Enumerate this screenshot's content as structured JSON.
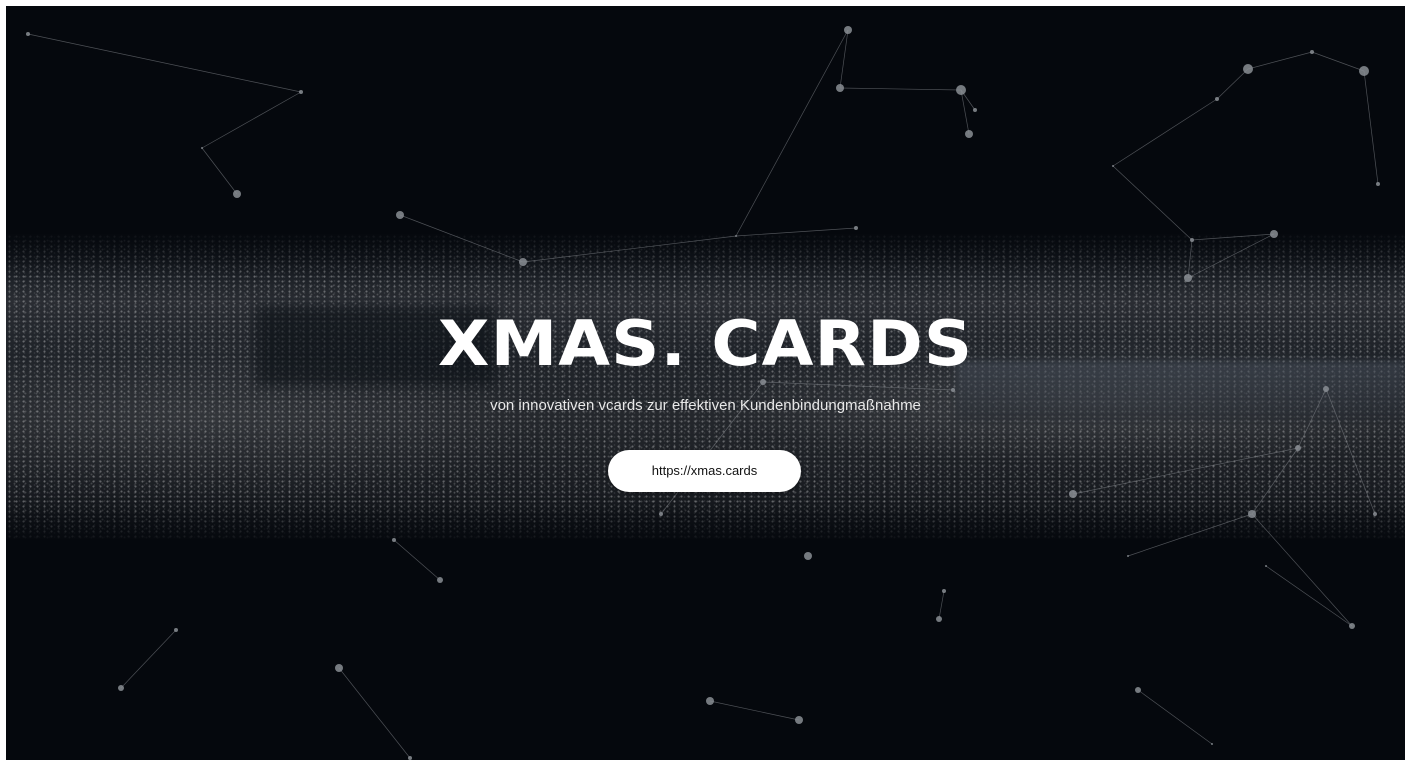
{
  "hero": {
    "title": "XMAS. CARDS",
    "subtitle": "von innovativen vcards zur effektiven Kundenbindungmaßnahme",
    "button_label": "https://xmas.cards"
  },
  "theme": {
    "background": "#05080d",
    "text": "#ffffff",
    "button_background": "#ffffff",
    "button_text": "#111111",
    "network_color": "#8a8e94"
  }
}
